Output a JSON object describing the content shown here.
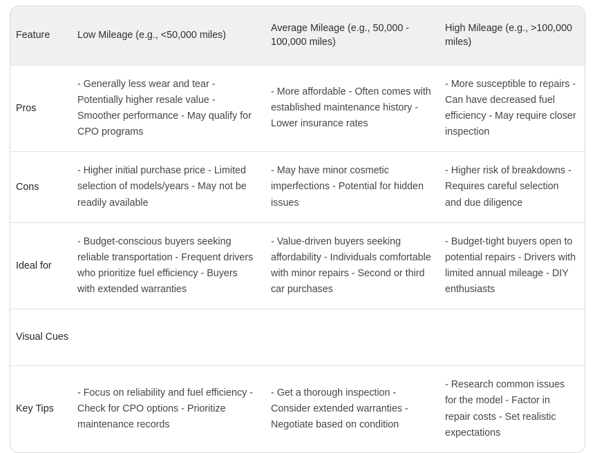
{
  "table": {
    "headers": [
      "Feature",
      "Low Mileage (e.g., <50,000 miles)",
      "Average Mileage (e.g., 50,000 - 100,000 miles)",
      "High Mileage (e.g., >100,000 miles)"
    ],
    "rows": [
      {
        "label": "Pros",
        "low": "- Generally less wear and tear - Potentially higher resale value - Smoother performance - May qualify for CPO programs",
        "average": "- More affordable - Often comes with established maintenance history - Lower insurance rates",
        "high": "- More susceptible to repairs - Can have decreased fuel efficiency - May require closer inspection"
      },
      {
        "label": "Cons",
        "low": "- Higher initial purchase price - Limited selection of models/years - May not be readily available",
        "average": "- May have minor cosmetic imperfections - Potential for hidden issues",
        "high": "- Higher risk of breakdowns - Requires careful selection and due diligence"
      },
      {
        "label": "Ideal for",
        "low": "- Budget-conscious buyers seeking reliable transportation - Frequent drivers who prioritize fuel efficiency - Buyers with extended warranties",
        "average": "- Value-driven buyers seeking affordability - Individuals comfortable with minor repairs - Second or third car purchases",
        "high": "- Budget-tight buyers open to potential repairs - Drivers with limited annual mileage - DIY enthusiasts"
      },
      {
        "label": "Visual Cues",
        "low": "",
        "average": "",
        "high": ""
      },
      {
        "label": "Key Tips",
        "low": "- Focus on reliability and fuel efficiency - Check for CPO options - Prioritize maintenance records",
        "average": "- Get a thorough inspection - Consider extended warranties - Negotiate based on condition",
        "high": "- Research common issues for the model - Factor in repair costs - Set realistic expectations"
      }
    ]
  },
  "colors": {
    "header_background": "#f1f0ee",
    "border": "#d8d8d6",
    "row_divider": "#e2e2e0",
    "body_text": "#45473f",
    "label_text": "#262724"
  }
}
